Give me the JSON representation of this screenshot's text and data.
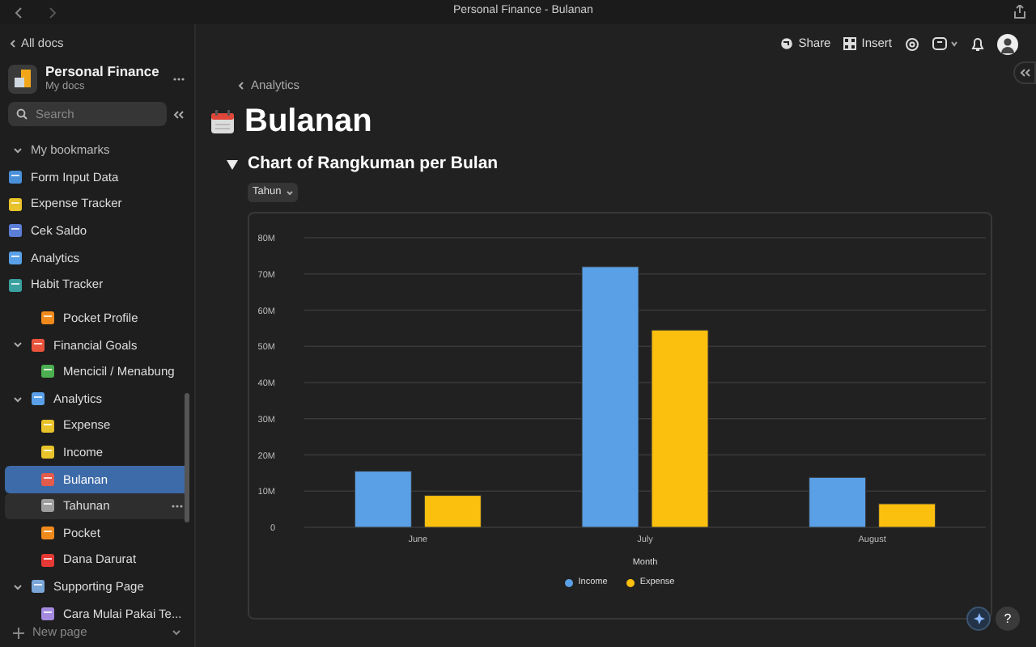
{
  "window": {
    "title": "Personal Finance - Bulanan"
  },
  "sidebar": {
    "back_link": "All docs",
    "workspace": {
      "name": "Personal Finance",
      "subtitle": "My docs"
    },
    "search": {
      "placeholder": "Search"
    },
    "bookmarks": {
      "label": "My bookmarks",
      "expanded": true,
      "items": [
        {
          "label": "Form Input Data",
          "color": "#4a90d9"
        },
        {
          "label": "Expense Tracker",
          "color": "#e8c32a"
        },
        {
          "label": "Cek Saldo",
          "color": "#5b7fd6"
        },
        {
          "label": "Analytics",
          "color": "#5aa0e8"
        },
        {
          "label": "Habit Tracker",
          "color": "#3aa0a0"
        }
      ]
    },
    "tree": [
      {
        "children": [
          {
            "label": "Pocket Profile",
            "color": "#f08a1c",
            "selected": false
          }
        ]
      },
      {
        "label": "Financial Goals",
        "color": "#e8543c",
        "expanded": true,
        "selected": false,
        "children": [
          {
            "label": "Mencicil / Menabung",
            "color": "#4caf50",
            "selected": false
          }
        ]
      },
      {
        "label": "Analytics",
        "color": "#5aa0e8",
        "expanded": true,
        "selected": false,
        "children": [
          {
            "label": "Expense",
            "color": "#e8c32a",
            "selected": false
          },
          {
            "label": "Income",
            "color": "#e8c32a",
            "selected": false
          },
          {
            "label": "Bulanan",
            "color": "#e25b4b",
            "selected": true
          },
          {
            "label": "Tahunan",
            "color": "#9e9e9e",
            "selected": false,
            "hovered": true
          },
          {
            "label": "Pocket",
            "color": "#f08a1c",
            "selected": false
          },
          {
            "label": "Dana Darurat",
            "color": "#e53935",
            "selected": false
          }
        ]
      },
      {
        "label": "Supporting Page",
        "color": "#7aa6d8",
        "expanded": true,
        "selected": false,
        "children": [
          {
            "label": "Cara Mulai Pakai Te...",
            "color": "#a58be0",
            "selected": false
          }
        ]
      }
    ],
    "new_page": "New page"
  },
  "toolbar": {
    "buttons": [
      {
        "kind": "share",
        "label": "Share"
      },
      {
        "kind": "insert",
        "label": "Insert"
      }
    ]
  },
  "page": {
    "breadcrumb": "Analytics",
    "title": "Bulanan",
    "section": {
      "title": "Chart of Rangkuman per Bulan",
      "expanded": true,
      "filter": "Tahun",
      "chart_data": {
        "type": "bar",
        "grid": true,
        "legend": true,
        "xlabel": "Month",
        "categories": [
          "June",
          "July",
          "August"
        ],
        "series": [
          {
            "name": "Income",
            "color": "#5aa0e6",
            "values": [
              15500000,
              72000000,
              13800000
            ]
          },
          {
            "name": "Expense",
            "color": "#fbbf0e",
            "values": [
              8800000,
              54500000,
              6500000
            ]
          }
        ],
        "ylim": [
          0,
          80000000
        ],
        "yticks": [
          {
            "value": 0,
            "label": "0"
          },
          {
            "value": 10000000,
            "label": "10M"
          },
          {
            "value": 20000000,
            "label": "20M"
          },
          {
            "value": 30000000,
            "label": "30M"
          },
          {
            "value": 40000000,
            "label": "40M"
          },
          {
            "value": 50000000,
            "label": "50M"
          },
          {
            "value": 60000000,
            "label": "60M"
          },
          {
            "value": 70000000,
            "label": "70M"
          },
          {
            "value": 80000000,
            "label": "80M"
          }
        ]
      }
    }
  },
  "help_button": "?"
}
